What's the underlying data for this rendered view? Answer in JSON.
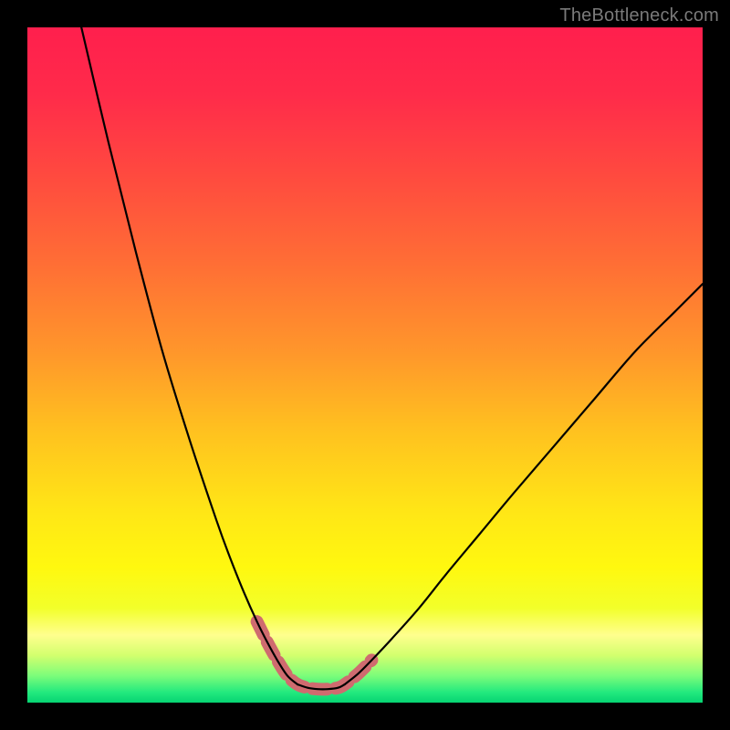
{
  "watermark": "TheBottleneck.com",
  "chart_data": {
    "type": "line",
    "title": "",
    "xlabel": "",
    "ylabel": "",
    "xlim": [
      0,
      100
    ],
    "ylim": [
      0,
      100
    ],
    "grid": false,
    "legend": false,
    "series": [
      {
        "name": "left-curve",
        "color": "#000000",
        "x": [
          8,
          12,
          16,
          20,
          24,
          28,
          30,
          32,
          34,
          35.5,
          37,
          38.5,
          40
        ],
        "values": [
          100,
          83,
          67,
          52,
          39,
          27,
          21.5,
          16.5,
          12,
          9,
          6.3,
          4,
          2.7
        ]
      },
      {
        "name": "right-curve",
        "color": "#000000",
        "x": [
          47,
          49,
          51,
          54,
          58,
          62,
          67,
          72,
          78,
          84,
          90,
          96,
          100
        ],
        "values": [
          2.7,
          4.3,
          6.3,
          9.5,
          14,
          19,
          25,
          31,
          38,
          45,
          52,
          58,
          62
        ]
      },
      {
        "name": "valley-floor",
        "color": "#000000",
        "x": [
          40,
          41.5,
          43,
          44.5,
          46,
          47
        ],
        "values": [
          2.7,
          2.2,
          2.0,
          2.0,
          2.2,
          2.7
        ]
      },
      {
        "name": "highlight-band",
        "color": "#cf6b6f",
        "x": [
          34,
          35.5,
          37,
          38.5,
          40,
          41.5,
          43,
          44.5,
          46,
          47,
          49,
          51
        ],
        "values": [
          12,
          9,
          6.3,
          4,
          2.7,
          2.2,
          2.0,
          2.0,
          2.2,
          2.7,
          4.3,
          6.3
        ]
      }
    ],
    "gradient_stops": [
      {
        "offset": 0.0,
        "color": "#ff1f4d"
      },
      {
        "offset": 0.1,
        "color": "#ff2b4a"
      },
      {
        "offset": 0.22,
        "color": "#ff4a3f"
      },
      {
        "offset": 0.35,
        "color": "#ff6e35"
      },
      {
        "offset": 0.48,
        "color": "#ff962b"
      },
      {
        "offset": 0.6,
        "color": "#ffc21f"
      },
      {
        "offset": 0.72,
        "color": "#ffe716"
      },
      {
        "offset": 0.8,
        "color": "#fff80f"
      },
      {
        "offset": 0.86,
        "color": "#f2ff2a"
      },
      {
        "offset": 0.9,
        "color": "#ffff8e"
      },
      {
        "offset": 0.93,
        "color": "#d3ff6e"
      },
      {
        "offset": 0.96,
        "color": "#7dfd7a"
      },
      {
        "offset": 0.985,
        "color": "#22e97e"
      },
      {
        "offset": 1.0,
        "color": "#06d472"
      }
    ]
  }
}
